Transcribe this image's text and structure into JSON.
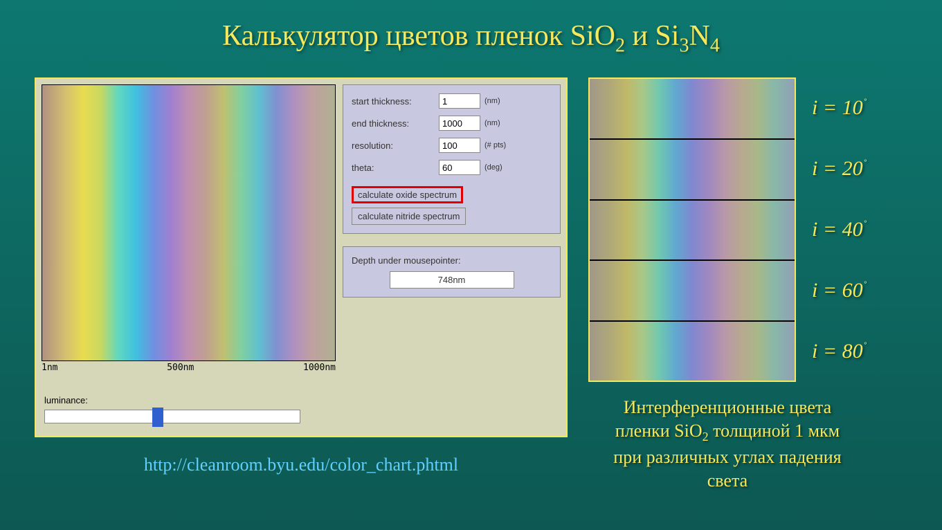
{
  "title_parts": {
    "prefix": "Калькулятор цветов пленок SiO",
    "sub1": "2",
    "mid": "  и Si",
    "sub2": "3",
    "mid2": "N",
    "sub3": "4"
  },
  "controls": {
    "start_label": "start thickness:",
    "start_value": "1",
    "start_unit": "(nm)",
    "end_label": "end thickness:",
    "end_value": "1000",
    "end_unit": "(nm)",
    "res_label": "resolution:",
    "res_value": "100",
    "res_unit": "(# pts)",
    "theta_label": "theta:",
    "theta_value": "60",
    "theta_unit": "(deg)",
    "calc_oxide": "calculate oxide spectrum",
    "calc_nitride": "calculate nitride spectrum"
  },
  "axis": {
    "t0": "1nm",
    "t1": "500nm",
    "t2": "1000nm"
  },
  "depth": {
    "label": "Depth under mousepointer:",
    "value": "748nm"
  },
  "luminance_label": "luminance:",
  "url": "http://cleanroom.byu.edu/color_chart.phtml",
  "angles": [
    "10",
    "20",
    "40",
    "60",
    "80"
  ],
  "caption_parts": {
    "l1": "Интерференционные цвета",
    "l2a": "пленки SiO",
    "l2sub": "2",
    "l2b": " толщиной 1 мкм",
    "l3": "при различных углах падения",
    "l4": "света"
  }
}
